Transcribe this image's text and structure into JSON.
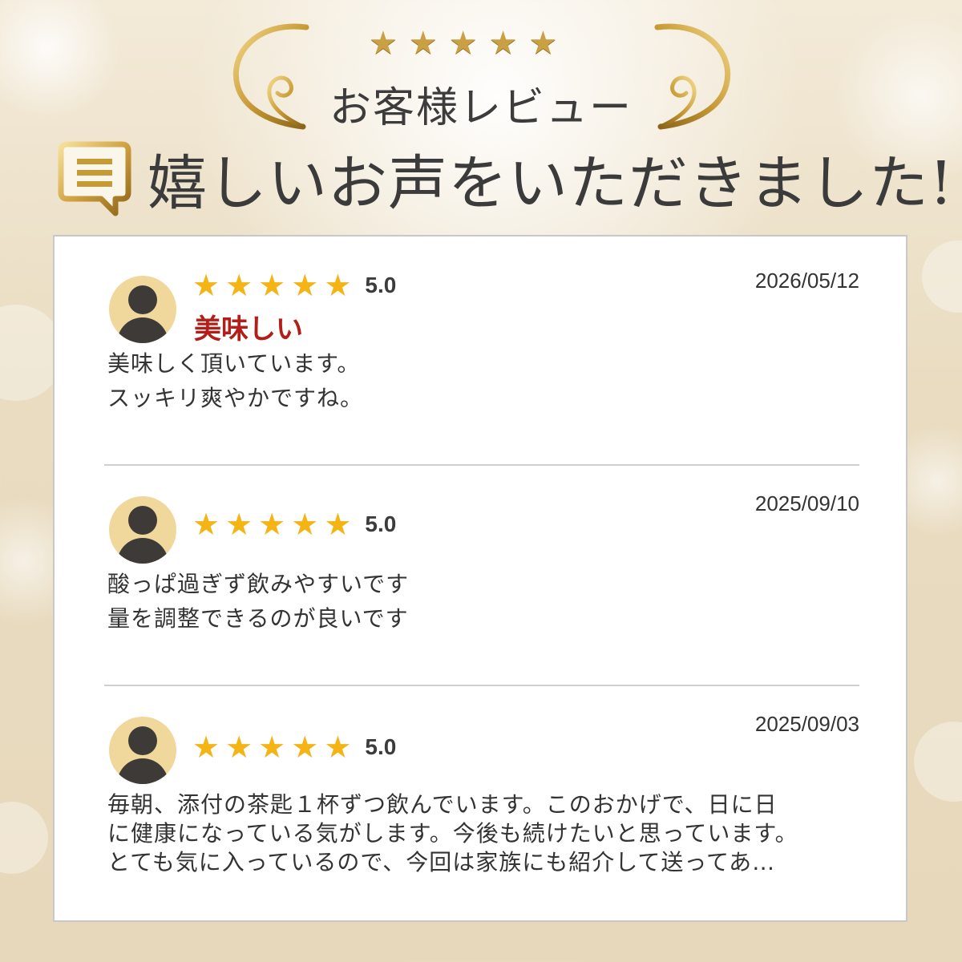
{
  "header": {
    "subtitle": "お客様レビュー",
    "title": "嬉しいお声をいただきました!",
    "top_star_count": 5,
    "colors": {
      "gold": "#c9a043",
      "text": "#3b3b3b"
    },
    "icon": "chat-bubble-icon"
  },
  "reviews": [
    {
      "rating_text": "5.0",
      "rating": 5,
      "date": "2026/05/12",
      "title": "美味しい",
      "lines": [
        "美味しく頂いています。",
        "スッキリ爽やかですね。"
      ]
    },
    {
      "rating_text": "5.0",
      "rating": 5,
      "date": "2025/09/10",
      "title": "",
      "lines": [
        "酸っぱ過ぎず飲みやすいです",
        "量を調整できるのが良いです"
      ]
    },
    {
      "rating_text": "5.0",
      "rating": 5,
      "date": "2025/09/03",
      "title": "",
      "lines": [
        "毎朝、添付の茶匙１杯ずつ飲んでいます。このおかげで、日に日",
        "に健康になっている気がします。今後も続けたいと思っています。",
        "とても気に入っているので、今回は家族にも紹介して送ってあ…"
      ]
    }
  ],
  "colors": {
    "star": "#f5b416",
    "title_red": "#b21f18",
    "avatar_bg": "#f0d89c",
    "avatar_fg": "#3d3a37"
  }
}
